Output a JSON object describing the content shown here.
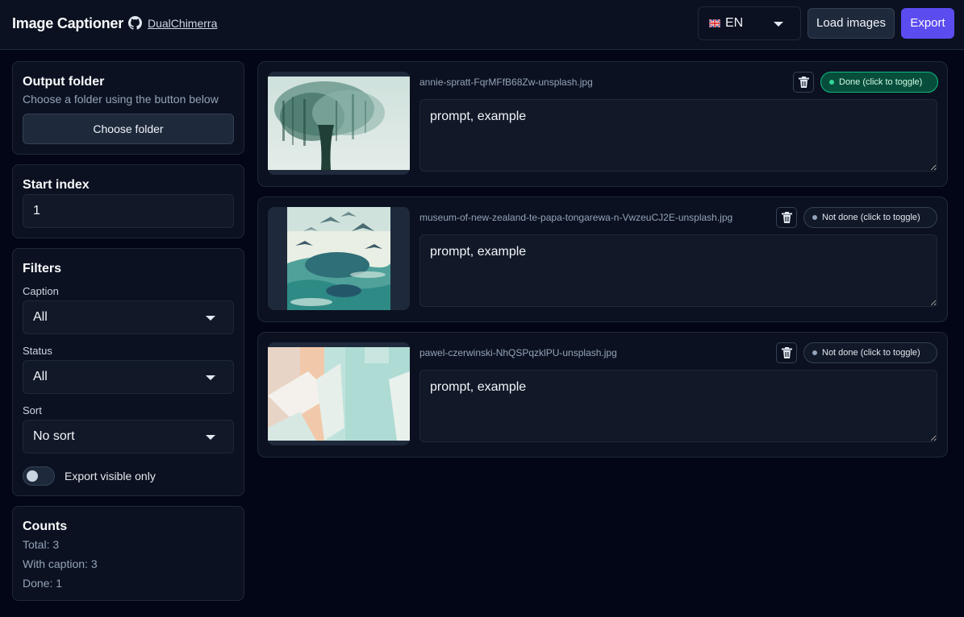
{
  "header": {
    "title": "Image Captioner",
    "github_user": "DualChimerra",
    "language": "EN",
    "load_label": "Load images",
    "export_label": "Export",
    "colors": {
      "accent": "#5b4cf0",
      "background": "#020617"
    }
  },
  "sidebar": {
    "output": {
      "title": "Output folder",
      "subtitle": "Choose a folder using the button below",
      "button_label": "Choose folder"
    },
    "start_index": {
      "title": "Start index",
      "value": "1"
    },
    "filters": {
      "title": "Filters",
      "caption_label": "Caption",
      "caption_value": "All",
      "status_label": "Status",
      "status_value": "All",
      "sort_label": "Sort",
      "sort_value": "No sort",
      "export_visible_label": "Export visible only",
      "export_visible_on": false
    },
    "counts": {
      "title": "Counts",
      "total": "Total: 3",
      "with_caption": "With caption: 3",
      "done": "Done: 1"
    }
  },
  "images": [
    {
      "filename": "annie-spratt-FqrMFfB68Zw-unsplash.jpg",
      "caption": "prompt, example",
      "status": "Done (click to toggle)",
      "done": true
    },
    {
      "filename": "museum-of-new-zealand-te-papa-tongarewa-n-VwzeuCJ2E-unsplash.jpg",
      "caption": "prompt, example",
      "status": "Not done (click to toggle)",
      "done": false
    },
    {
      "filename": "pawel-czerwinski-NhQSPqzklPU-unsplash.jpg",
      "caption": "prompt, example",
      "status": "Not done (click to toggle)",
      "done": false
    }
  ]
}
